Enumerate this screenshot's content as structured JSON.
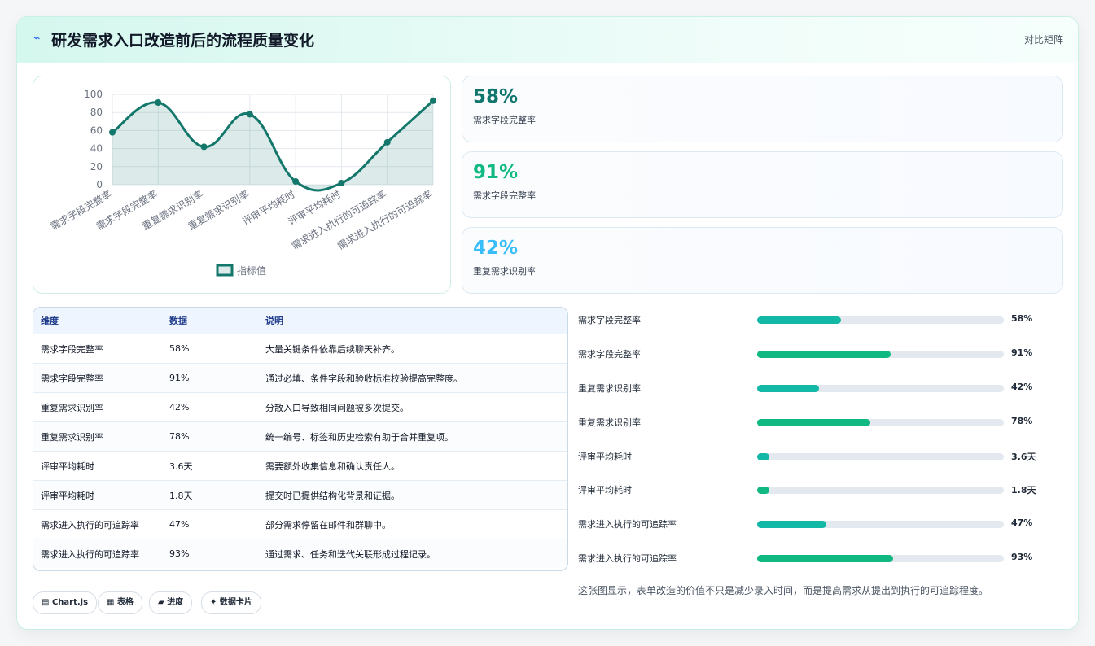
{
  "header": {
    "title": "研发需求入口改造前后的流程质量变化",
    "tag": "对比矩阵",
    "icon": "lightning-icon"
  },
  "chart_data": {
    "type": "line",
    "categories": [
      "需求字段完整率",
      "需求字段完整率",
      "重复需求识别率",
      "重复需求识别率",
      "评审平均耗时",
      "评审平均耗时",
      "需求进入执行的可追踪率",
      "需求进入执行的可追踪率"
    ],
    "series": [
      {
        "name": "指标值",
        "values": [
          58,
          91,
          42,
          78,
          3.6,
          1.8,
          47,
          93
        ]
      }
    ],
    "ylim": [
      0,
      100
    ],
    "yticks": [
      0,
      20,
      40,
      60,
      80,
      100
    ],
    "legend": "bottom",
    "grid": true,
    "color": "#14776b"
  },
  "stats": [
    {
      "value": "58%",
      "label": "需求字段完整率",
      "color": "#0f766e"
    },
    {
      "value": "91%",
      "label": "需求字段完整率",
      "color": "#10b981"
    },
    {
      "value": "42%",
      "label": "重复需求识别率",
      "color": "#38bdf8"
    }
  ],
  "table": {
    "headers": [
      "维度",
      "数据",
      "说明"
    ],
    "rows": [
      [
        "需求字段完整率",
        "58%",
        "大量关键条件依靠后续聊天补齐。"
      ],
      [
        "需求字段完整率",
        "91%",
        "通过必填、条件字段和验收标准校验提高完整度。"
      ],
      [
        "重复需求识别率",
        "42%",
        "分散入口导致相同问题被多次提交。"
      ],
      [
        "重复需求识别率",
        "78%",
        "统一编号、标签和历史检索有助于合并重复项。"
      ],
      [
        "评审平均耗时",
        "3.6天",
        "需要额外收集信息和确认责任人。"
      ],
      [
        "评审平均耗时",
        "1.8天",
        "提交时已提供结构化背景和证据。"
      ],
      [
        "需求进入执行的可追踪率",
        "47%",
        "部分需求停留在邮件和群聊中。"
      ],
      [
        "需求进入执行的可追踪率",
        "93%",
        "通过需求、任务和迭代关联形成过程记录。"
      ]
    ]
  },
  "progress": [
    {
      "label": "需求字段完整率",
      "value": "58%",
      "fraction": 0.34,
      "color": "#14b8a6"
    },
    {
      "label": "需求字段完整率",
      "value": "91%",
      "fraction": 0.54,
      "color": "#10b981"
    },
    {
      "label": "重复需求识别率",
      "value": "42%",
      "fraction": 0.25,
      "color": "#14b8a6"
    },
    {
      "label": "重复需求识别率",
      "value": "78%",
      "fraction": 0.46,
      "color": "#10b981"
    },
    {
      "label": "评审平均耗时",
      "value": "3.6天",
      "fraction": 0.05,
      "color": "#14b8a6"
    },
    {
      "label": "评审平均耗时",
      "value": "1.8天",
      "fraction": 0.05,
      "color": "#10b981"
    },
    {
      "label": "需求进入执行的可追踪率",
      "value": "47%",
      "fraction": 0.28,
      "color": "#14b8a6"
    },
    {
      "label": "需求进入执行的可追踪率",
      "value": "93%",
      "fraction": 0.55,
      "color": "#10b981"
    }
  ],
  "note": "这张图显示，表单改造的价值不只是减少录入时间，而是提高需求从提出到执行的可追踪程度。",
  "chips": [
    {
      "icon": "chart-icon",
      "label": "Chart.js"
    },
    {
      "icon": "table-icon",
      "label": "表格"
    },
    {
      "icon": "folder-icon",
      "label": "进度"
    },
    {
      "icon": "sparkle-icon",
      "label": "数据卡片"
    }
  ]
}
